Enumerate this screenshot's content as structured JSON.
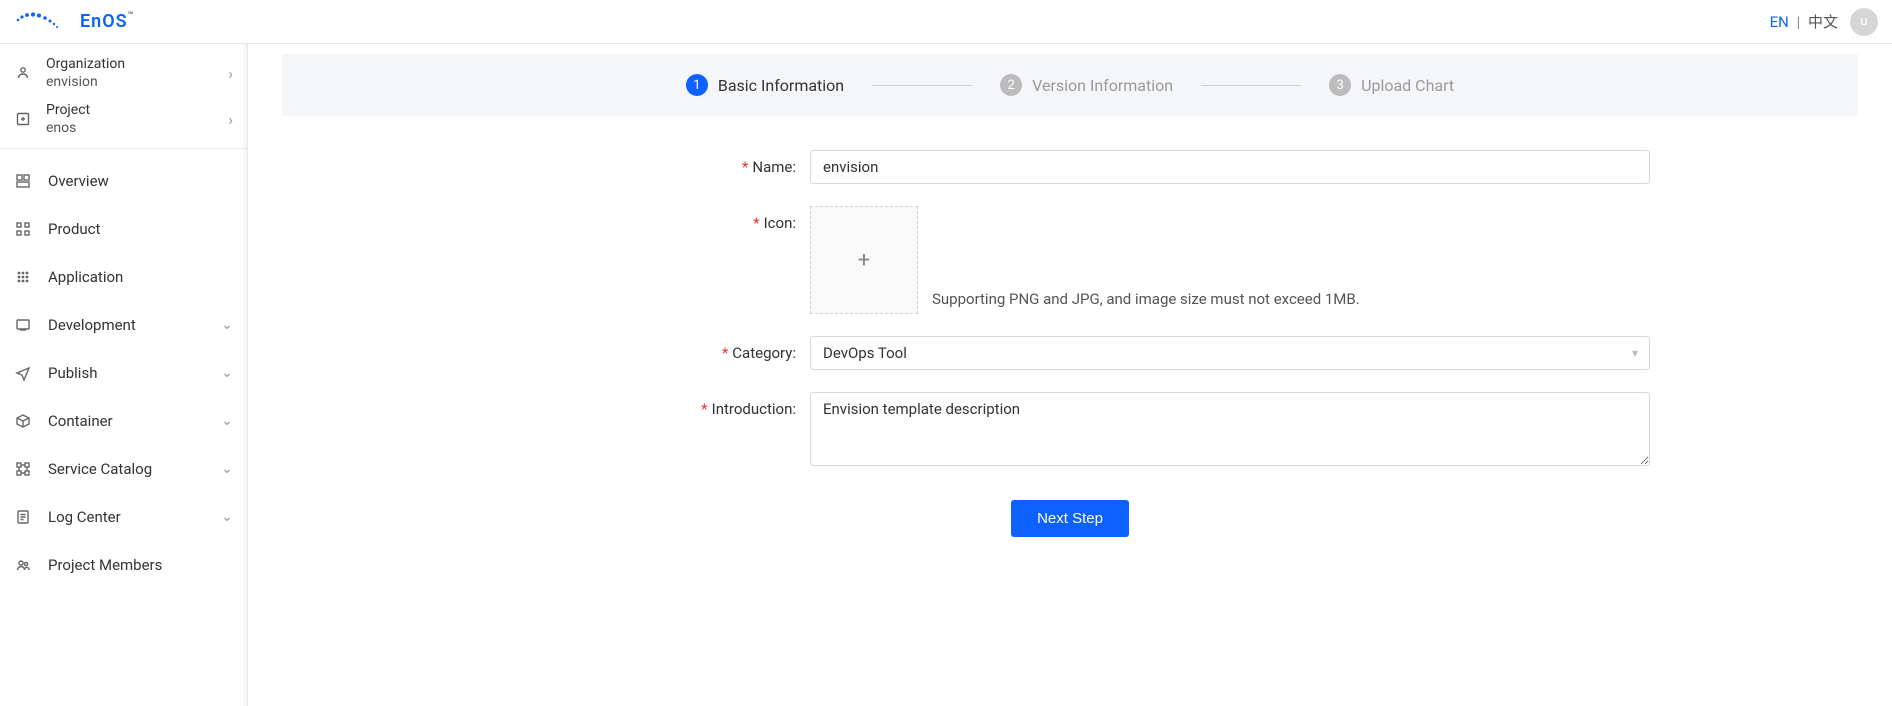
{
  "header": {
    "lang_en": "EN",
    "lang_sep": "|",
    "lang_cn": "中文",
    "avatar_initial": "u",
    "logo_text": "EnOS",
    "logo_tm": "™"
  },
  "sidebar": {
    "org": {
      "label": "Organization",
      "value": "envision"
    },
    "project": {
      "label": "Project",
      "value": "enos"
    },
    "nav": [
      {
        "label": "Overview",
        "icon": "dashboard-icon",
        "expandable": false
      },
      {
        "label": "Product",
        "icon": "grid-icon",
        "expandable": false
      },
      {
        "label": "Application",
        "icon": "apps-icon",
        "expandable": false
      },
      {
        "label": "Development",
        "icon": "dev-icon",
        "expandable": true
      },
      {
        "label": "Publish",
        "icon": "send-icon",
        "expandable": true
      },
      {
        "label": "Container",
        "icon": "container-icon",
        "expandable": true
      },
      {
        "label": "Service Catalog",
        "icon": "catalog-icon",
        "expandable": true
      },
      {
        "label": "Log Center",
        "icon": "log-icon",
        "expandable": true
      },
      {
        "label": "Project Members",
        "icon": "members-icon",
        "expandable": false
      }
    ]
  },
  "stepper": {
    "steps": [
      {
        "num": "1",
        "label": "Basic Information"
      },
      {
        "num": "2",
        "label": "Version Information"
      },
      {
        "num": "3",
        "label": "Upload Chart"
      }
    ],
    "active_index": 0
  },
  "form": {
    "name_label": "Name:",
    "name_value": "envision",
    "icon_label": "Icon:",
    "icon_hint": "Supporting PNG and JPG, and image size must not exceed 1MB.",
    "category_label": "Category:",
    "category_value": "DevOps Tool",
    "intro_label": "Introduction:",
    "intro_value": "Envision template description",
    "next_button": "Next Step"
  }
}
